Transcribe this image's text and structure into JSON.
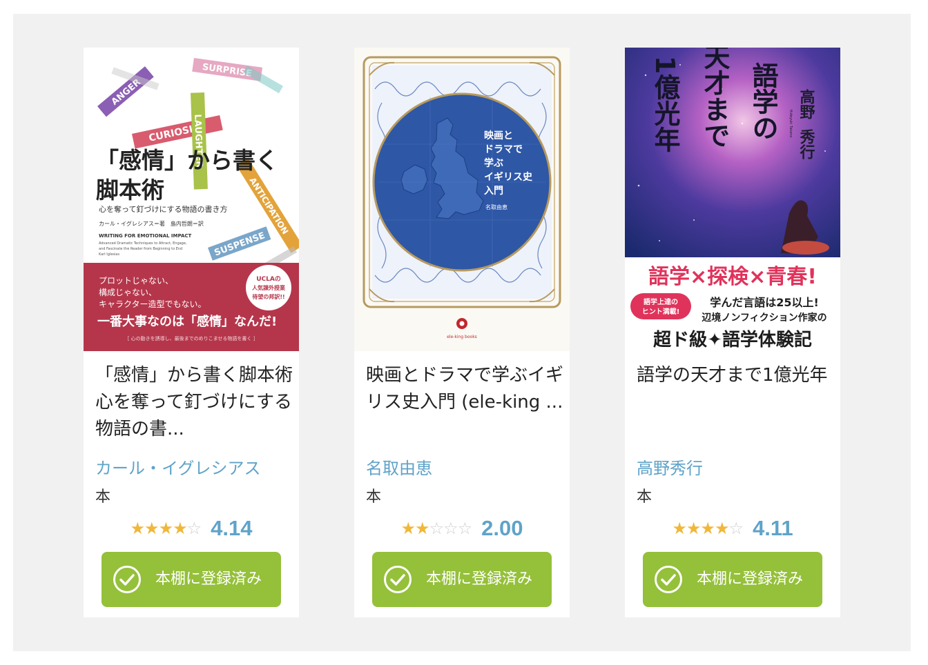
{
  "books": [
    {
      "title": "「感情」から書く脚本術 心を奪って釘づけにする物語の書...",
      "author": "カール・イグレシアス",
      "kind": "本",
      "rating": 4.14,
      "rating_label": "4.14",
      "stars_filled": 4,
      "button_label": "本棚に登録済み",
      "cover": {
        "main_title_line1": "「感情」から書く",
        "main_title_line2": "脚本術",
        "subtitle": "心を奪って釘づけにする物語の書き方",
        "credits": "カール・イグレシアス＝著　島内哲朗＝訳",
        "english_title": "WRITING FOR EMOTIONAL IMPACT",
        "english_sub1": "Advanced Dramatic Techniques to Attract, Engage,",
        "english_sub2": "and Fascinate the Reader from Beginning to End",
        "english_author": "Karl Iglesias",
        "words": [
          "SURPRISE",
          "ANGER",
          "CURIOSITY",
          "LAUGHTER",
          "ANTICIPATION",
          "SUSPENSE"
        ],
        "band_line1": "プロットじゃない、",
        "band_line2": "構成じゃない、",
        "band_line3": "キャラクター造型でもない。",
        "band_headline": "一番大事なのは「感情」なんだ!",
        "band_footer": "［ 心の動きを誘導し、最後までのめりこませる物語を書く ］",
        "badge_line1": "UCLAの",
        "badge_line2": "人気課外授業",
        "badge_line3": "待望の邦訳!!",
        "band_color": "#b5364b"
      }
    },
    {
      "title": "映画とドラマで学ぶイギリス史入門 (ele-king ...",
      "author": "名取由恵",
      "kind": "本",
      "rating": 2.0,
      "rating_label": "2.00",
      "stars_filled": 2,
      "button_label": "本棚に登録済み",
      "cover": {
        "title_line1": "映画と",
        "title_line2": "ドラマで",
        "title_line3": "学ぶ",
        "title_line4": "イギリス史",
        "title_line5": "入門",
        "author": "名取由恵",
        "publisher": "ele-king books",
        "circle_color": "#2e57a6"
      }
    },
    {
      "title": "語学の天才まで1億光年",
      "author": "高野秀行",
      "kind": "本",
      "rating": 4.11,
      "rating_label": "4.11",
      "stars_filled": 4,
      "button_label": "本棚に登録済み",
      "cover": {
        "col1": "高野",
        "col1b": "秀行",
        "col2": "語学の",
        "col3": "天才まで",
        "col4": "1億光年",
        "romaji": "Hideyuki Takano",
        "tagline": "語学×探検×青春!",
        "badge_line1": "語学上達の",
        "badge_line2": "ヒント満載!",
        "blurb_line1": "学んだ言語は25以上!",
        "blurb_line2": "辺境ノンフィクション作家の",
        "blurb_line3": "超ド級✦語学体験記",
        "tagline_color": "#e0335b"
      }
    }
  ]
}
